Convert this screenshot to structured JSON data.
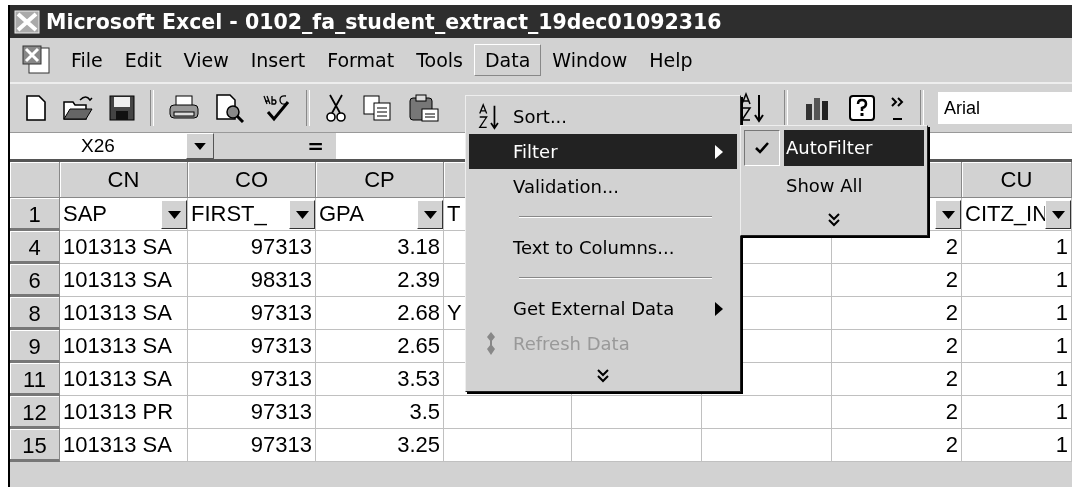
{
  "window": {
    "title": "Microsoft Excel - 0102_fa_student_extract_19dec01092316"
  },
  "menu_bar": [
    {
      "label": "File",
      "selected": false
    },
    {
      "label": "Edit",
      "selected": false
    },
    {
      "label": "View",
      "selected": false
    },
    {
      "label": "Insert",
      "selected": false
    },
    {
      "label": "Format",
      "selected": false
    },
    {
      "label": "Tools",
      "selected": false
    },
    {
      "label": "Data",
      "selected": true
    },
    {
      "label": "Window",
      "selected": false
    },
    {
      "label": "Help",
      "selected": false
    }
  ],
  "toolbar": {
    "font_field": {
      "value": "Arial"
    }
  },
  "formula_bar": {
    "name_box": "X26",
    "equals": "="
  },
  "sheet": {
    "columns": [
      {
        "header": "CN"
      },
      {
        "header": "CO"
      },
      {
        "header": "CP"
      },
      {},
      {},
      {},
      {},
      {
        "header": "CU"
      }
    ],
    "rows": [
      {
        "header": "1",
        "kind": "filter",
        "cells": [
          "SAP",
          "FIRST_",
          "GPA",
          "T",
          null,
          null,
          null,
          "CITZ_IN"
        ]
      },
      {
        "header": "4",
        "kind": "data",
        "cells": [
          "101313 SA",
          "97313",
          "3.18",
          null,
          null,
          null,
          "2",
          "1"
        ]
      },
      {
        "header": "6",
        "kind": "data",
        "cells": [
          "101313 SA",
          "98313",
          "2.39",
          null,
          null,
          null,
          "2",
          "1"
        ]
      },
      {
        "header": "8",
        "kind": "data",
        "cells": [
          "101313 SA",
          "97313",
          "2.68",
          "Y",
          null,
          null,
          "2",
          "1"
        ]
      },
      {
        "header": "9",
        "kind": "data",
        "cells": [
          "101313 SA",
          "97313",
          "2.65",
          null,
          null,
          null,
          "2",
          "1"
        ]
      },
      {
        "header": "11",
        "kind": "data",
        "cells": [
          "101313 SA",
          "97313",
          "3.53",
          null,
          null,
          null,
          "2",
          "1"
        ]
      },
      {
        "header": "12",
        "kind": "data",
        "cells": [
          "101313 PR",
          "97313",
          "3.5",
          null,
          null,
          null,
          "2",
          "1"
        ]
      },
      {
        "header": "15",
        "kind": "data",
        "cells": [
          "101313 SA",
          "97313",
          "3.25",
          null,
          null,
          null,
          "2",
          "1"
        ]
      }
    ]
  },
  "data_menu": [
    {
      "kind": "command",
      "label": "Sort...",
      "selected": false,
      "disabled": false
    },
    {
      "kind": "submenu",
      "label": "Filter",
      "selected": true,
      "disabled": false
    },
    {
      "kind": "command",
      "label": "Validation...",
      "selected": false,
      "disabled": false
    },
    {
      "kind": "separator"
    },
    {
      "kind": "command",
      "label": "Text to Columns...",
      "selected": false,
      "disabled": false
    },
    {
      "kind": "separator"
    },
    {
      "kind": "submenu",
      "label": "Get External Data",
      "selected": false,
      "disabled": false
    },
    {
      "kind": "command",
      "label": "Refresh Data",
      "selected": false,
      "disabled": true
    },
    {
      "kind": "more"
    }
  ],
  "filter_submenu": [
    {
      "kind": "command",
      "label": "AutoFilter",
      "checked": true,
      "selected": true
    },
    {
      "kind": "command",
      "label": "Show All",
      "checked": false,
      "selected": false
    },
    {
      "kind": "more"
    }
  ]
}
